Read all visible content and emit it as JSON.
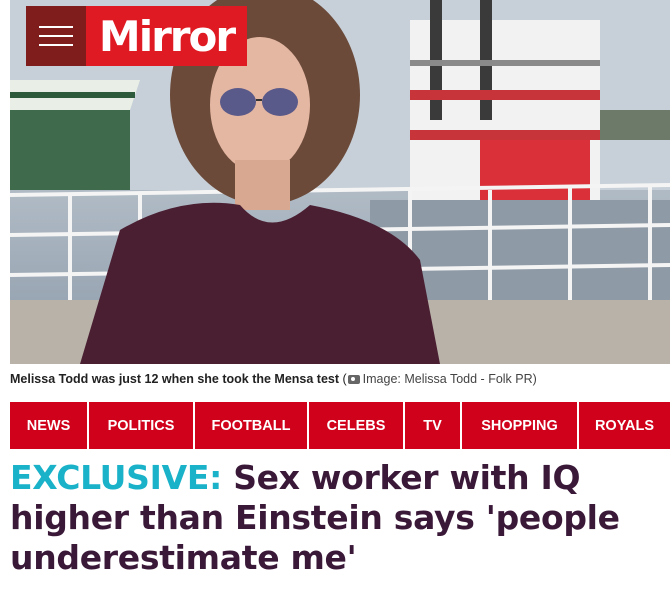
{
  "masthead": {
    "logo_text": "Mirror",
    "menu_icon": "hamburger-menu-icon",
    "brand_color": "#e01a22"
  },
  "hero": {
    "image_description_icon": "photo"
  },
  "caption": {
    "text": "Melissa Todd was just 12 when she took the Mensa test",
    "open_paren": " (",
    "credit": "Image: Melissa Todd - Folk PR)",
    "icon": "camera-icon"
  },
  "nav": {
    "bg_color": "#d0021b",
    "items": [
      {
        "label": "NEWS"
      },
      {
        "label": "POLITICS"
      },
      {
        "label": "FOOTBALL"
      },
      {
        "label": "CELEBS"
      },
      {
        "label": "TV"
      },
      {
        "label": "SHOPPING"
      },
      {
        "label": "ROYALS"
      }
    ]
  },
  "headline": {
    "tag": "EXCLUSIVE:",
    "text": "Sex worker with IQ higher than Einstein says 'people underestimate me'",
    "tag_color": "#1ab2c9",
    "text_color": "#3a1838"
  }
}
